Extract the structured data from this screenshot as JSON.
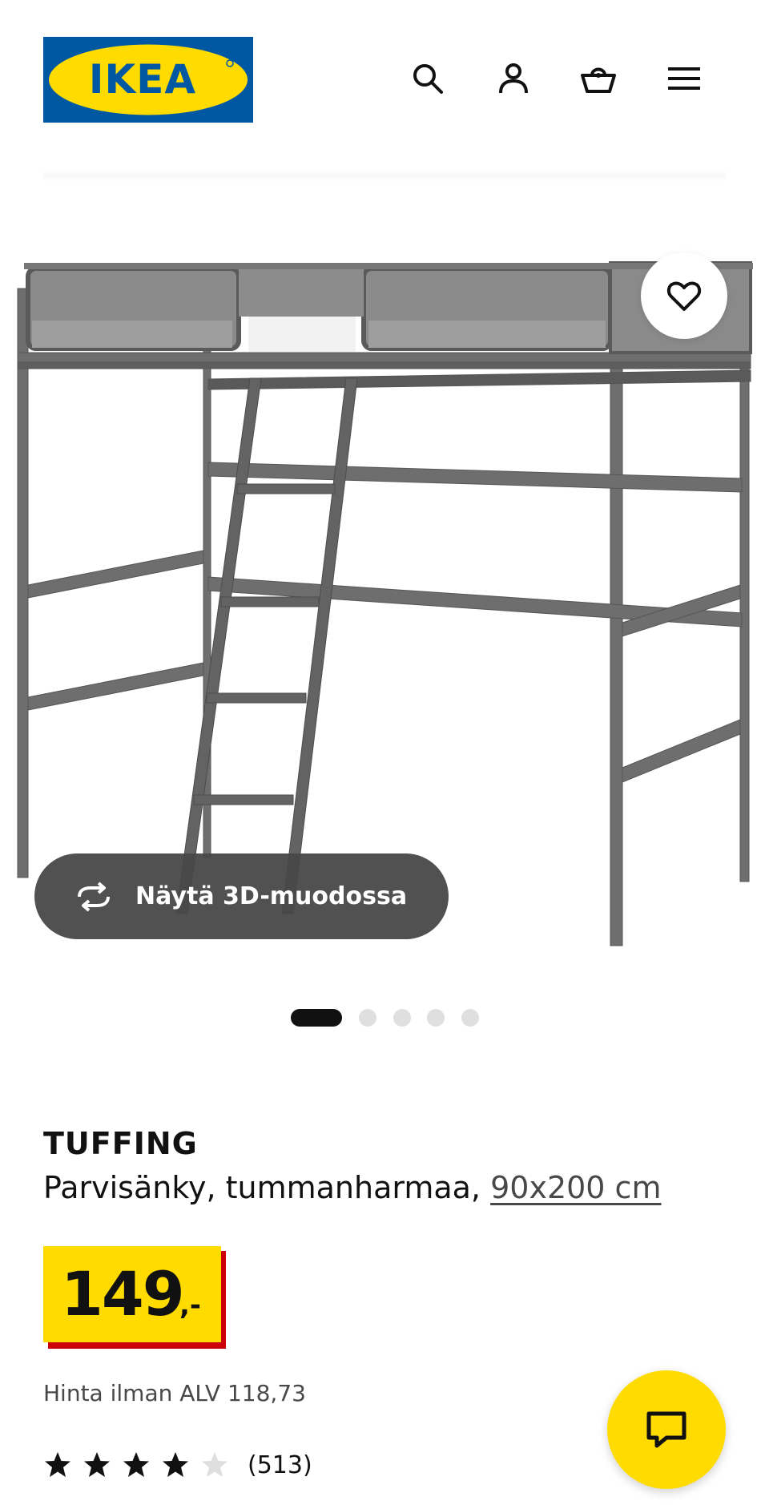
{
  "header": {
    "logo_text": "IKEA",
    "brand_colors": {
      "blue": "#0058a3",
      "yellow": "#ffdb00"
    },
    "icons": [
      "search-icon",
      "account-icon",
      "cart-icon",
      "menu-icon"
    ]
  },
  "gallery": {
    "favorite_icon": "heart-icon",
    "view_3d_label": "Näytä 3D-muodossa",
    "view_3d_icon": "rotate-3d-icon",
    "image_count": 5,
    "active_image": 1
  },
  "product": {
    "name": "TUFFING",
    "description": "Parvisänky, tummanharmaa,",
    "size_link": "90x200 cm",
    "price_integer": "149",
    "price_decimal": ",-",
    "price_colors": {
      "tag": "#ffdb00",
      "shadow": "#cc0008"
    },
    "vat_label": "Hinta ilman ALV 118,73",
    "rating": 4.5,
    "rating_max": 5,
    "review_count": "(513)"
  },
  "chat": {
    "icon": "chat-icon"
  }
}
